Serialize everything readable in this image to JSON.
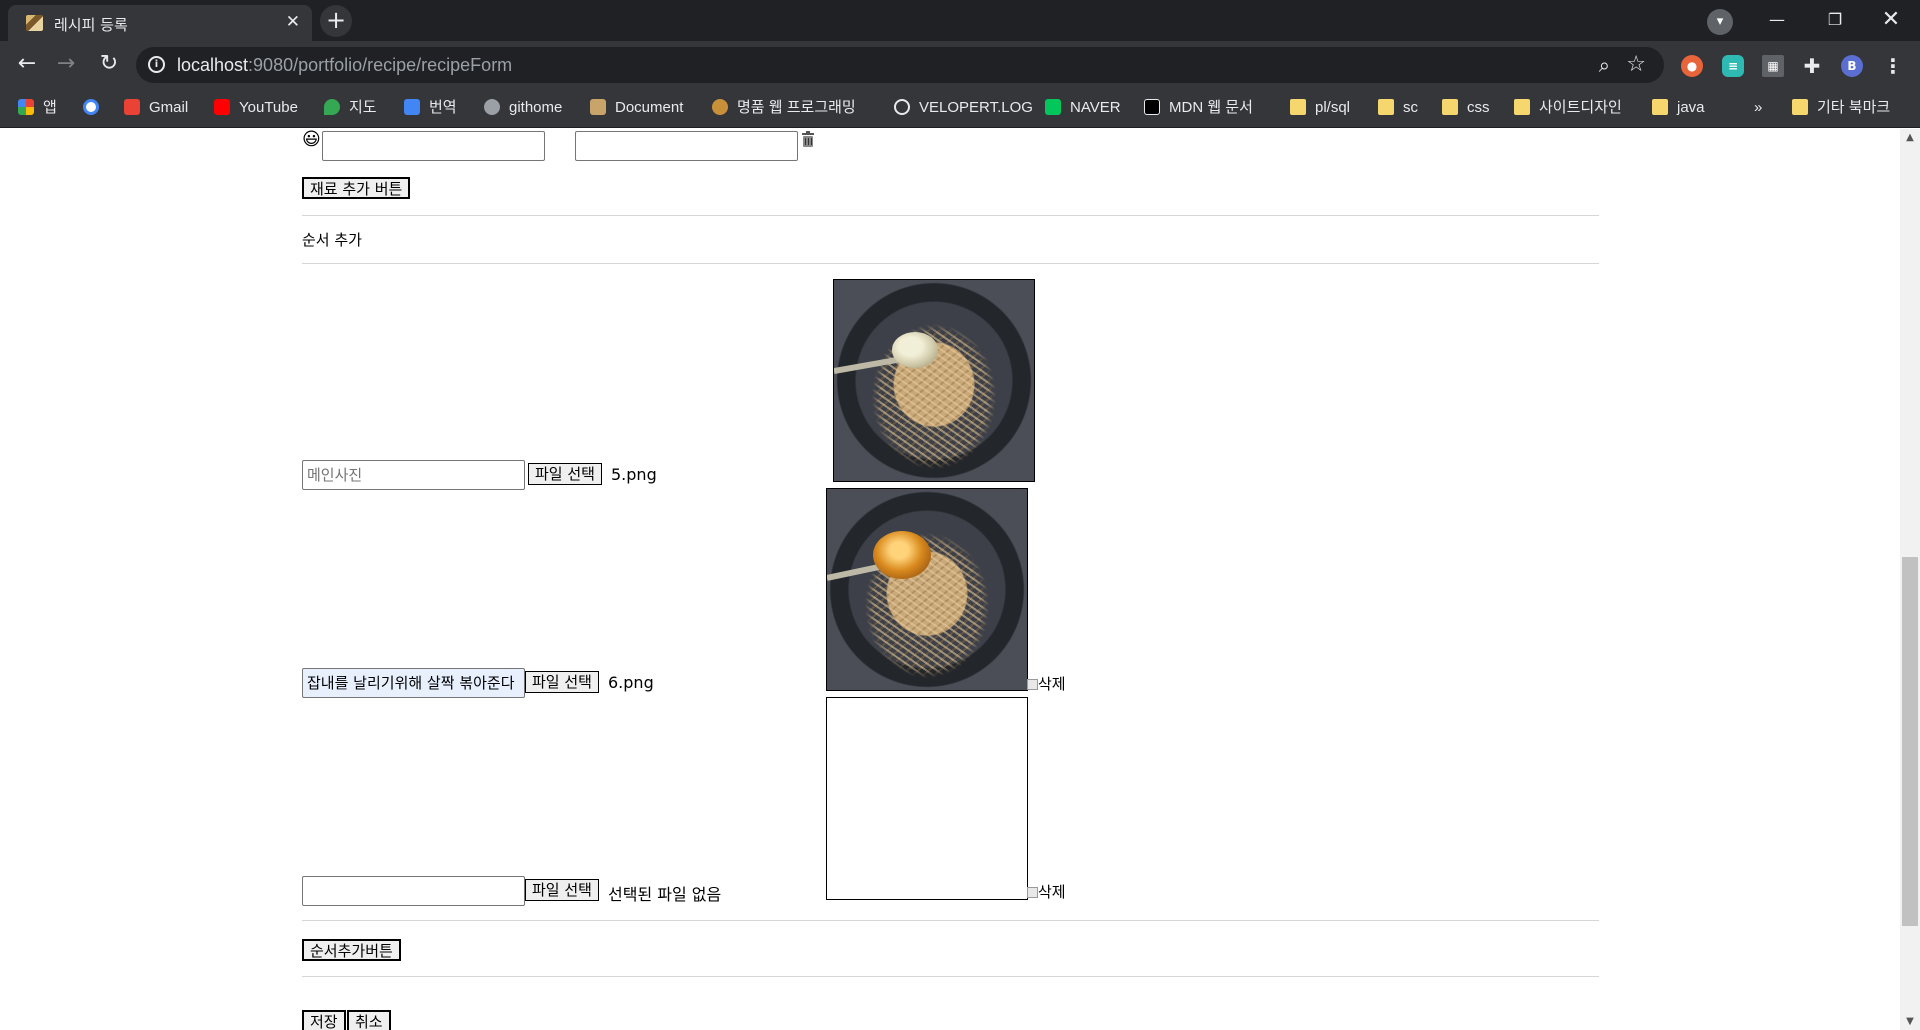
{
  "browser": {
    "tab_title": "레시피 등록",
    "url_host": "localhost",
    "url_rest": ":9080/portfolio/recipe/recipeForm",
    "profile_initial": "B",
    "bookmarks": [
      {
        "label": "앱",
        "icon": "apps-grid-icon",
        "color": "#ea4335"
      },
      {
        "label": "",
        "icon": "google-icon",
        "color": "#4285f4"
      },
      {
        "label": "Gmail",
        "icon": "gmail-icon",
        "color": "#ea4335"
      },
      {
        "label": "YouTube",
        "icon": "youtube-icon",
        "color": "#ff0000"
      },
      {
        "label": "지도",
        "icon": "maps-pin-icon",
        "color": "#34a853"
      },
      {
        "label": "번역",
        "icon": "translate-icon",
        "color": "#4285f4"
      },
      {
        "label": "githome",
        "icon": "globe-icon",
        "color": "#9aa0a6"
      },
      {
        "label": "Document",
        "icon": "document-icon",
        "color": "#c9a46a"
      },
      {
        "label": "명품 웹 프로그래밍",
        "icon": "site-icon",
        "color": "#c9903a"
      },
      {
        "label": "VELOPERT.LOG",
        "icon": "velopert-icon",
        "color": "#e8eaed"
      },
      {
        "label": "NAVER",
        "icon": "naver-icon",
        "color": "#03c75a"
      },
      {
        "label": "MDN 웹 문서",
        "icon": "mdn-icon",
        "color": "#000000"
      },
      {
        "label": "pl/sql",
        "icon": "folder-icon",
        "color": "#f5d76e"
      },
      {
        "label": "sc",
        "icon": "folder-icon",
        "color": "#f5d76e"
      },
      {
        "label": "css",
        "icon": "folder-icon",
        "color": "#f5d76e"
      },
      {
        "label": "사이트디자인",
        "icon": "folder-icon",
        "color": "#f5d76e"
      },
      {
        "label": "java",
        "icon": "folder-icon",
        "color": "#f5d76e"
      }
    ],
    "more_bookmarks": "»",
    "other_bookmarks": "기타 북마크"
  },
  "ingredient_row": {
    "name_value": "",
    "amount_value": ""
  },
  "add_ingredient_button": "재료 추가 버튼",
  "step_section_label": "순서 추가",
  "steps": [
    {
      "text_value": "",
      "placeholder": "메인사진",
      "file_button": "파일 선택",
      "file_name": "5.png",
      "delete_label": ""
    },
    {
      "text_value": "잡내를 날리기위해 살짝 볶아준다",
      "placeholder": "",
      "file_button": "파일 선택",
      "file_name": "6.png",
      "delete_label": "삭제"
    },
    {
      "text_value": "",
      "placeholder": "",
      "file_button": "파일 선택",
      "file_name": "선택된 파일 없음",
      "delete_label": "삭제"
    }
  ],
  "add_step_button": "순서추가버튼",
  "save_button": "저장",
  "cancel_button": "취소",
  "colors": {
    "chrome_dark": "#202124",
    "chrome_mid": "#35363a",
    "autofill": "#e8f0fe"
  }
}
